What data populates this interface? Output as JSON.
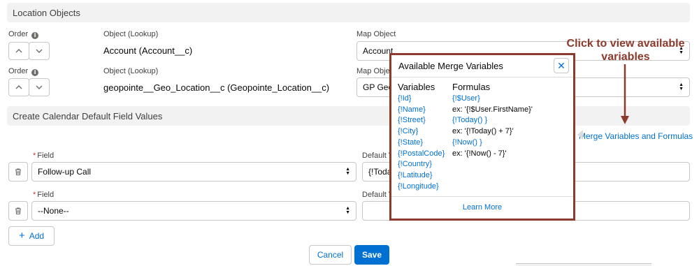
{
  "location_objects": {
    "section_title": "Location Objects",
    "order_label": "Order",
    "object_label": "Object (Lookup)",
    "map_object_label": "Map Object",
    "map_object_label_trunc": "Map Objec",
    "rows": [
      {
        "object": "Account (Account__c)",
        "map_object": "Account"
      },
      {
        "object": "geopointe__Geo_Location__c (Geopointe_Location__c)",
        "map_object": "GP Geo"
      }
    ]
  },
  "calendar_defaults": {
    "section_title": "Create Calendar Default Field Values",
    "merge_link": "Merge Variables and Formulas",
    "field_label": "Field",
    "default_value_label": "Default V",
    "rows": [
      {
        "field": "Follow-up Call",
        "default_value": "{!Toda"
      },
      {
        "field": "--None--",
        "default_value": ""
      }
    ],
    "add_label": "Add"
  },
  "footer": {
    "cancel_label": "Cancel",
    "save_label": "Save"
  },
  "popover": {
    "title": "Available Merge Variables",
    "variables_title": "Variables",
    "formulas_title": "Formulas",
    "variables": [
      "{!Id}",
      "{!Name}",
      "{!Street}",
      "{!City}",
      "{!State}",
      "{!PostalCode}",
      "{!Country}",
      "{!Latitude}",
      "{!Longitude}"
    ],
    "formulas": [
      {
        "text": "{!$User}",
        "link": true
      },
      {
        "text": "ex: '{!$User.FirstName}'",
        "link": false
      },
      {
        "text": "{!Today() }",
        "link": true
      },
      {
        "text": "ex: '{!Today() + 7}'",
        "link": false
      },
      {
        "text": "{!Now() }",
        "link": true
      },
      {
        "text": "ex: '{!Now() - 7}'",
        "link": false
      }
    ],
    "learn_more": "Learn More",
    "close_glyph": "✕"
  },
  "annotation": {
    "line1": "Click to view available",
    "line2": "variables"
  },
  "colors": {
    "accent": "#0070d2",
    "annotation": "#8b3a2b",
    "section_bg": "#f3f2f2",
    "border": "#c9c7c5"
  }
}
